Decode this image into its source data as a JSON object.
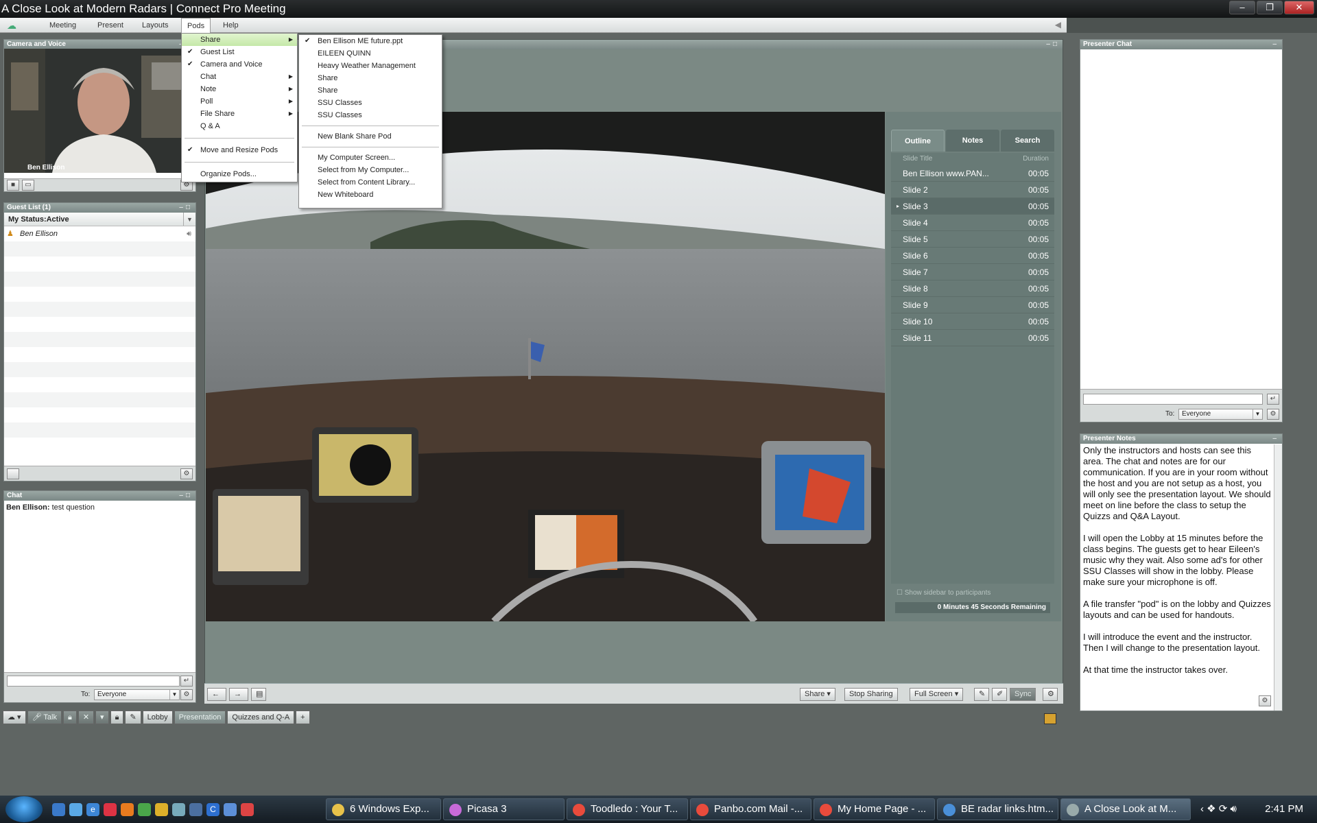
{
  "window": {
    "title": "A Close Look at Modern Radars | Connect Pro Meeting",
    "buttons": {
      "minimize": "–",
      "restore": "❐",
      "close": "✕"
    }
  },
  "menubar": {
    "items": [
      "Meeting",
      "Present",
      "Layouts",
      "Pods",
      "Help"
    ]
  },
  "pods_menu": {
    "items": [
      {
        "label": "Share",
        "checked": false,
        "submenu": true,
        "highlight": true
      },
      {
        "label": "Guest List",
        "checked": true,
        "submenu": false
      },
      {
        "label": "Camera and Voice",
        "checked": true,
        "submenu": false
      },
      {
        "label": "Chat",
        "checked": false,
        "submenu": true
      },
      {
        "label": "Note",
        "checked": false,
        "submenu": true
      },
      {
        "label": "Poll",
        "checked": false,
        "submenu": true
      },
      {
        "label": "File Share",
        "checked": false,
        "submenu": true
      },
      {
        "label": "Q & A",
        "checked": false,
        "submenu": false
      }
    ],
    "move_resize": "Move and Resize Pods",
    "organize": "Organize Pods..."
  },
  "share_submenu": {
    "items": [
      "Ben Ellison ME future.ppt",
      "EILEEN QUINN",
      "Heavy Weather Management",
      "Share",
      "Share",
      "SSU Classes",
      "SSU Classes"
    ],
    "new_blank": "New Blank Share Pod",
    "sources": [
      "My Computer Screen...",
      "Select from My Computer...",
      "Select from Content Library...",
      "New Whiteboard"
    ]
  },
  "camera_pod": {
    "title": "Camera and Voice",
    "person": "Ben Ellison"
  },
  "guest_pod": {
    "title": "Guest List (1)",
    "status": "My Status:Active",
    "guests": [
      "Ben Ellison"
    ]
  },
  "chat_pod": {
    "title": "Chat",
    "messages": [
      {
        "author": "Ben Ellison:",
        "text": " test question"
      }
    ],
    "to_label": "To:",
    "recipient": "Everyone"
  },
  "sidebar": {
    "tabs": [
      "Outline",
      "Notes",
      "Search"
    ],
    "col_title": "Slide Title",
    "col_duration": "Duration",
    "slides": [
      {
        "title": "Ben Ellison www.PAN...",
        "duration": "00:05"
      },
      {
        "title": "Slide 2",
        "duration": "00:05"
      },
      {
        "title": "Slide 3",
        "duration": "00:05"
      },
      {
        "title": "Slide 4",
        "duration": "00:05"
      },
      {
        "title": "Slide 5",
        "duration": "00:05"
      },
      {
        "title": "Slide 6",
        "duration": "00:05"
      },
      {
        "title": "Slide 7",
        "duration": "00:05"
      },
      {
        "title": "Slide 8",
        "duration": "00:05"
      },
      {
        "title": "Slide 9",
        "duration": "00:05"
      },
      {
        "title": "Slide 10",
        "duration": "00:05"
      },
      {
        "title": "Slide 11",
        "duration": "00:05"
      }
    ],
    "selected_index": 2,
    "show_sidebar": "Show sidebar to participants",
    "remaining": "0 Minutes 45 Seconds Remaining"
  },
  "share_footer": {
    "share": "Share",
    "stop_sharing": "Stop Sharing",
    "full_screen": "Full Screen",
    "sync": "Sync"
  },
  "presenter_chat": {
    "title": "Presenter Chat",
    "to_label": "To:",
    "recipient": "Everyone"
  },
  "presenter_notes": {
    "title": "Presenter Notes",
    "paragraphs": [
      "Only the instructors and hosts can see this area.  The chat and notes are for our communication. If you are in your room without the host and you are not setup as a host, you will only see the presentation layout.  We should meet on line before the class to setup the Quizzs and Q&A Layout.",
      "I will open the Lobby at 15 minutes before the class begins.  The guests get to hear Eileen's music why they wait.  Also some ad's for other SSU Classes will show in the lobby.  Please make sure your microphone is off.",
      "A file transfer \"pod\"  is on the lobby and Quizzes layouts and can be used for handouts.",
      "I will introduce the event and the instructor.  Then I will change to the presentation layout.",
      "At that time the instructor takes over."
    ]
  },
  "layout_bar": {
    "talk": "Talk",
    "layouts": [
      "Lobby",
      "Presentation",
      "Quizzes and Q-A"
    ],
    "add": "+"
  },
  "taskbar": {
    "buttons": [
      {
        "label": "6 Windows Exp...",
        "color": "#e8c24a"
      },
      {
        "label": "Picasa 3",
        "color": "#c86ad8"
      },
      {
        "label": "Toodledo : Your T...",
        "color": "#e94b3c"
      },
      {
        "label": "Panbo.com Mail -...",
        "color": "#e94b3c"
      },
      {
        "label": "My Home Page - ...",
        "color": "#e94b3c"
      },
      {
        "label": "BE radar links.htm...",
        "color": "#4a8fd8"
      },
      {
        "label": "A Close Look at M...",
        "color": "#9aa"
      }
    ],
    "clock": "2:41 PM"
  }
}
